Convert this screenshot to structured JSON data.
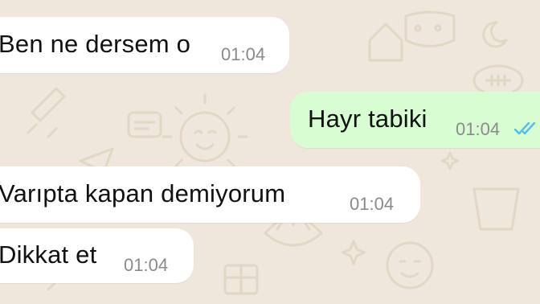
{
  "chat": {
    "messages": [
      {
        "direction": "incoming",
        "text": "Ben ne dersem o",
        "time": "01:04"
      },
      {
        "direction": "outgoing",
        "text": "Hayr tabiki",
        "time": "01:04",
        "status": "read-double-check-icon"
      },
      {
        "direction": "incoming",
        "text": "Varıpta kapan demiyorum",
        "time": "01:04"
      },
      {
        "direction": "incoming",
        "text": "Dikkat et",
        "time": "01:04"
      }
    ]
  },
  "colors": {
    "background": "#efe7dc",
    "incoming_bubble": "#ffffff",
    "outgoing_bubble": "#d9fdd3",
    "read_ticks": "#53bdeb"
  }
}
